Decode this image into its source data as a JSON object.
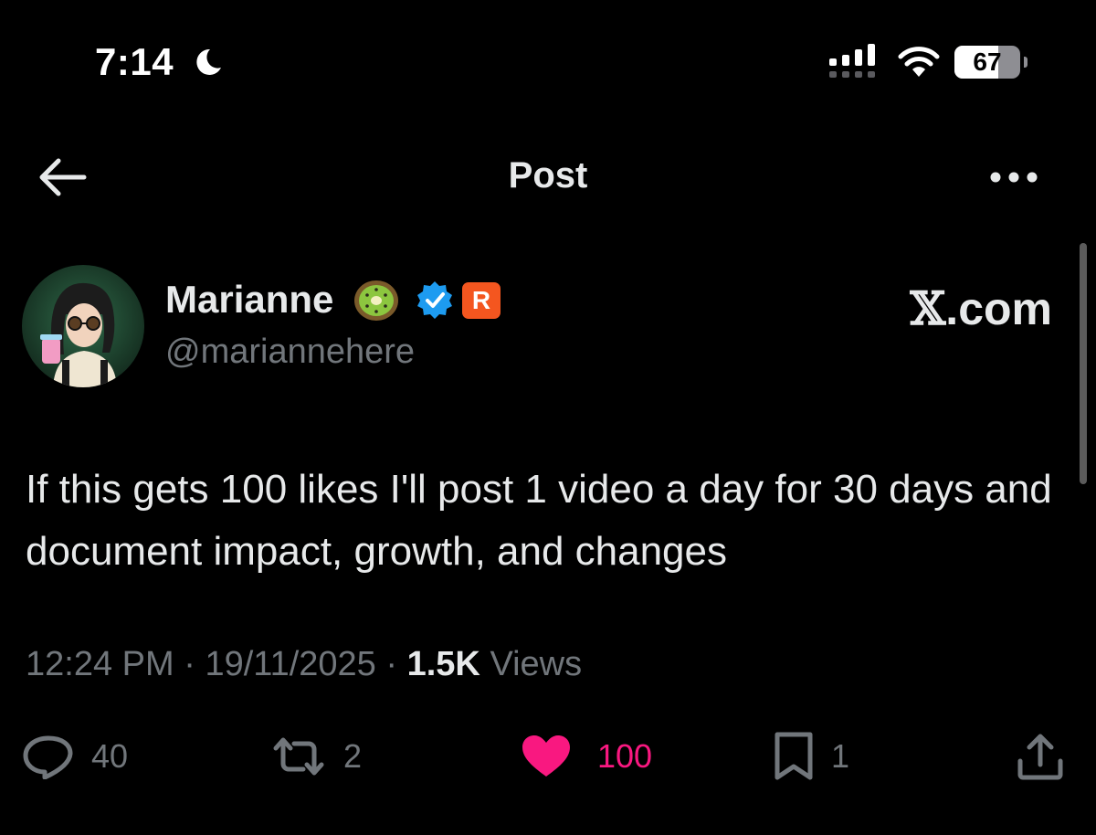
{
  "status_bar": {
    "time": "7:14",
    "battery_level": "67",
    "icons": [
      "moon-icon",
      "signal-icon",
      "wifi-icon",
      "battery-icon"
    ]
  },
  "nav": {
    "title": "Post",
    "icons": [
      "back-arrow-icon",
      "more-icon"
    ]
  },
  "author": {
    "display_name": "Marianne",
    "handle": "@mariannehere",
    "badges": [
      "kiwi-emoji-icon",
      "verified-icon",
      "r-badge"
    ],
    "r_badge_label": "R",
    "watermark_x": "𝕏",
    "watermark_domain": ".com"
  },
  "tweet": {
    "text": "If this gets 100 likes I'll post 1 video a day for 30 days and document impact, growth, and changes",
    "time": "12:24 PM",
    "separator": "·",
    "date": "19/11/2025",
    "views_count": "1.5K",
    "views_label": "Views"
  },
  "actions": {
    "replies": "40",
    "reposts": "2",
    "likes": "100",
    "bookmarks": "1"
  },
  "colors": {
    "background": "#000000",
    "text": "#e7e9ea",
    "secondary_text": "#71767b",
    "like_pink": "#f91880",
    "verified_blue": "#1d9bf0",
    "r_badge_orange": "#f4561f"
  }
}
